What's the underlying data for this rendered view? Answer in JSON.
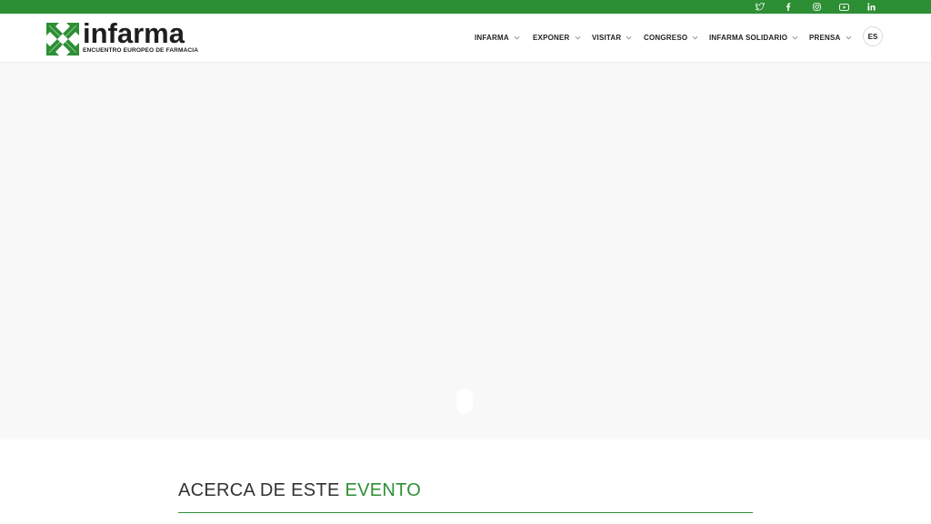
{
  "topbar": {
    "color": "#2d8f34",
    "social_icons": [
      "twitter-icon",
      "facebook-icon",
      "instagram-icon",
      "youtube-icon",
      "linkedin-icon"
    ]
  },
  "logo": {
    "word": "infarma",
    "tagline": "ENCUENTRO EUROPEO DE FARMACIA"
  },
  "nav": {
    "items": [
      {
        "label": "INFARMA"
      },
      {
        "label": "EXPONER"
      },
      {
        "label": "VISITAR"
      },
      {
        "label": "CONGRESO"
      },
      {
        "label": "INFARMA SOLIDARIO"
      },
      {
        "label": "PRENSA"
      }
    ],
    "language": "ES"
  },
  "about": {
    "title_main": "ACERCA DE ESTE",
    "title_accent": "EVENTO",
    "accent_color": "#2d8f34"
  }
}
